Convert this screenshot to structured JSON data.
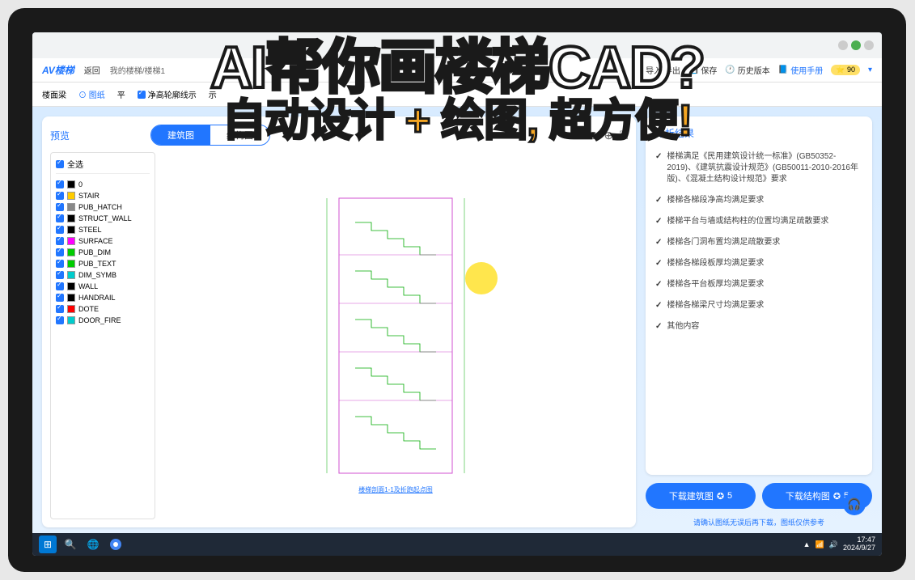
{
  "overlay": {
    "line1": "AI帮你画楼梯CAD?",
    "line2": "自动设计 + 绘图, 超方便!"
  },
  "header": {
    "logo": "AV楼梯",
    "back": "返回",
    "breadcrumb": "我的楼梯/楼梯1",
    "import": "导入/导出",
    "save": "保存",
    "history": "历史版本",
    "manual": "使用手册",
    "coins": "90"
  },
  "toolbar": {
    "title": "楼面梁",
    "drawConfig": "图纸",
    "opt1": "平",
    "opt2": "净高轮廓线示",
    "opt3": "示"
  },
  "preview": {
    "title": "预览",
    "tab1": "建筑图",
    "tab2": "结构图",
    "selectAll": "全选",
    "drawingLabel": "楼梯剖面1-1及折跑起点图"
  },
  "layers": [
    {
      "name": "0",
      "color": "#000000"
    },
    {
      "name": "STAIR",
      "color": "#ffcc00"
    },
    {
      "name": "PUB_HATCH",
      "color": "#888888"
    },
    {
      "name": "STRUCT_WALL",
      "color": "#000000"
    },
    {
      "name": "STEEL",
      "color": "#000000"
    },
    {
      "name": "SURFACE",
      "color": "#ff00ff"
    },
    {
      "name": "PUB_DIM",
      "color": "#00cc00"
    },
    {
      "name": "PUB_TEXT",
      "color": "#00cc00"
    },
    {
      "name": "DIM_SYMB",
      "color": "#00cccc"
    },
    {
      "name": "WALL",
      "color": "#000000"
    },
    {
      "name": "HANDRAIL",
      "color": "#000000"
    },
    {
      "name": "DOTE",
      "color": "#ff0000"
    },
    {
      "name": "DOOR_FIRE",
      "color": "#00cccc"
    }
  ],
  "results": {
    "title": "分析结果",
    "items": [
      "楼梯满足《民用建筑设计统一标准》(GB50352-2019)、《建筑抗震设计规范》(GB50011-2010-2016年版)、《混凝土结构设计规范》要求",
      "楼梯各梯段净高均满足要求",
      "楼梯平台与墙或结构柱的位置均满足疏散要求",
      "楼梯各门洞布置均满足疏散要求",
      "楼梯各梯段板厚均满足要求",
      "楼梯各平台板厚均满足要求",
      "楼梯各梯梁尺寸均满足要求",
      "其他内容"
    ]
  },
  "downloads": {
    "arch": "下载建筑图",
    "archCost": "5",
    "struct": "下载结构图",
    "structCost": "5",
    "note": "请确认图纸无误后再下载，图纸仅供参考"
  },
  "taskbar": {
    "time": "17:47",
    "date": "2024/9/27"
  }
}
